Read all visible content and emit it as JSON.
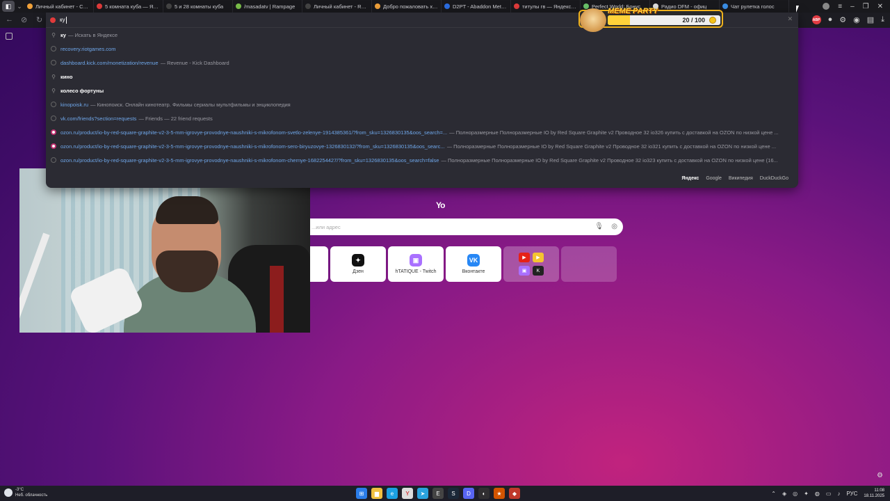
{
  "tabs": [
    {
      "title": "Личный кабинет - Comet",
      "color": "#f0a13a"
    },
    {
      "title": "5 комната куба — Яндекс",
      "color": "#e13b3b"
    },
    {
      "title": "5 и 28 комнаты куба",
      "color": "#444"
    },
    {
      "title": "/masadatv | Rampage",
      "color": "#7bbf4a"
    },
    {
      "title": "Личный кабинет - Ramp",
      "color": "#444"
    },
    {
      "title": "Добро пожаловать хаяг",
      "color": "#f0a13a"
    },
    {
      "title": "D2PT - Abaddon Meta It",
      "color": "#2b6de2"
    },
    {
      "title": "титулы гв — Яндекс: наш",
      "color": "#e13b3b"
    },
    {
      "title": "Perfect World: Бонус",
      "color": "#6ac26a"
    },
    {
      "title": "Радио DFM - офиц",
      "color": "#ddd"
    },
    {
      "title": "Чат рулетка голос",
      "color": "#3a8ee6"
    }
  ],
  "omnibox": {
    "query": "ку",
    "suggestions": [
      {
        "type": "search",
        "main": "ку",
        "desc": "— Искать в Яндексе"
      },
      {
        "type": "history",
        "main": "recovery.riotgames.com",
        "desc": ""
      },
      {
        "type": "history",
        "main": "dashboard.kick.com/monetization/revenue",
        "desc": "— Revenue - Kick Dashboard"
      },
      {
        "type": "search-bold",
        "main": "кино",
        "desc": ""
      },
      {
        "type": "search-bold",
        "main": "колесо фортуны",
        "desc": ""
      },
      {
        "type": "history",
        "main": "kinopoisk.ru",
        "desc": "— Кинопоиск. Онлайн кинотеатр. Фильмы сериалы мультфильмы и энциклопедия"
      },
      {
        "type": "history",
        "main": "vk.com/friends?section=requests",
        "desc": "— Friends — 22 friend requests"
      },
      {
        "type": "ozon",
        "main": "ozon.ru/product/io-by-red-square-graphite-v2-3-5-mm-igrovye-provodnye-naushniki-s-mikrofonom-svetlo-zelenye-1914385361/?from_sku=1326830135&oos_search=...",
        "desc": "— Полноразмерные Полноразмерные IO by Red Square Graphite v2 Проводное 32 io326 купить с доставкой на OZON по низкой цене ..."
      },
      {
        "type": "ozon",
        "main": "ozon.ru/product/io-by-red-square-graphite-v2-3-5-mm-igrovye-provodnye-naushniki-s-mikrofonom-sero-biryuzovye-1326830132/?from_sku=1326830135&oos_searc...",
        "desc": "— Полноразмерные Полноразмерные IO by Red Square Graphite v2 Проводное 32 io321 купить с доставкой на OZON по низкой цене ..."
      },
      {
        "type": "history",
        "main": "ozon.ru/product/io-by-red-square-graphite-v2-3-5-mm-igrovye-provodnye-naushniki-s-mikrofonom-chernye-1682254427/?from_sku=1326830135&oos_search=false",
        "desc": "— Полноразмерные Полноразмерные IO by Red Square Graphite v2 Проводное 32 io323 купить с доставкой на OZON по низкой цене (16..."
      }
    ],
    "engines": [
      "Яндекс",
      "Google",
      "Википедия",
      "DuckDuckGo"
    ]
  },
  "meme_party": {
    "title": "MEME PARTY",
    "score_text": "20 / 100",
    "progress_fraction": 0.2
  },
  "newtab": {
    "logo": "Yo",
    "search_placeholder": "...или адрес",
    "tiles": [
      {
        "label": "Дзен",
        "icon": "✦",
        "color": "#111111"
      },
      {
        "label": "hTATIQUE - Twitch",
        "icon": "▣",
        "color": "#a970ff"
      },
      {
        "label": "Вконтакте",
        "icon": "VK",
        "color": "#2787f5"
      }
    ]
  },
  "taskbar": {
    "temperature": "-3°C",
    "weather": "Неб. облачность",
    "lang": "РУС",
    "time": "11:08",
    "date": "18.11.2025"
  }
}
